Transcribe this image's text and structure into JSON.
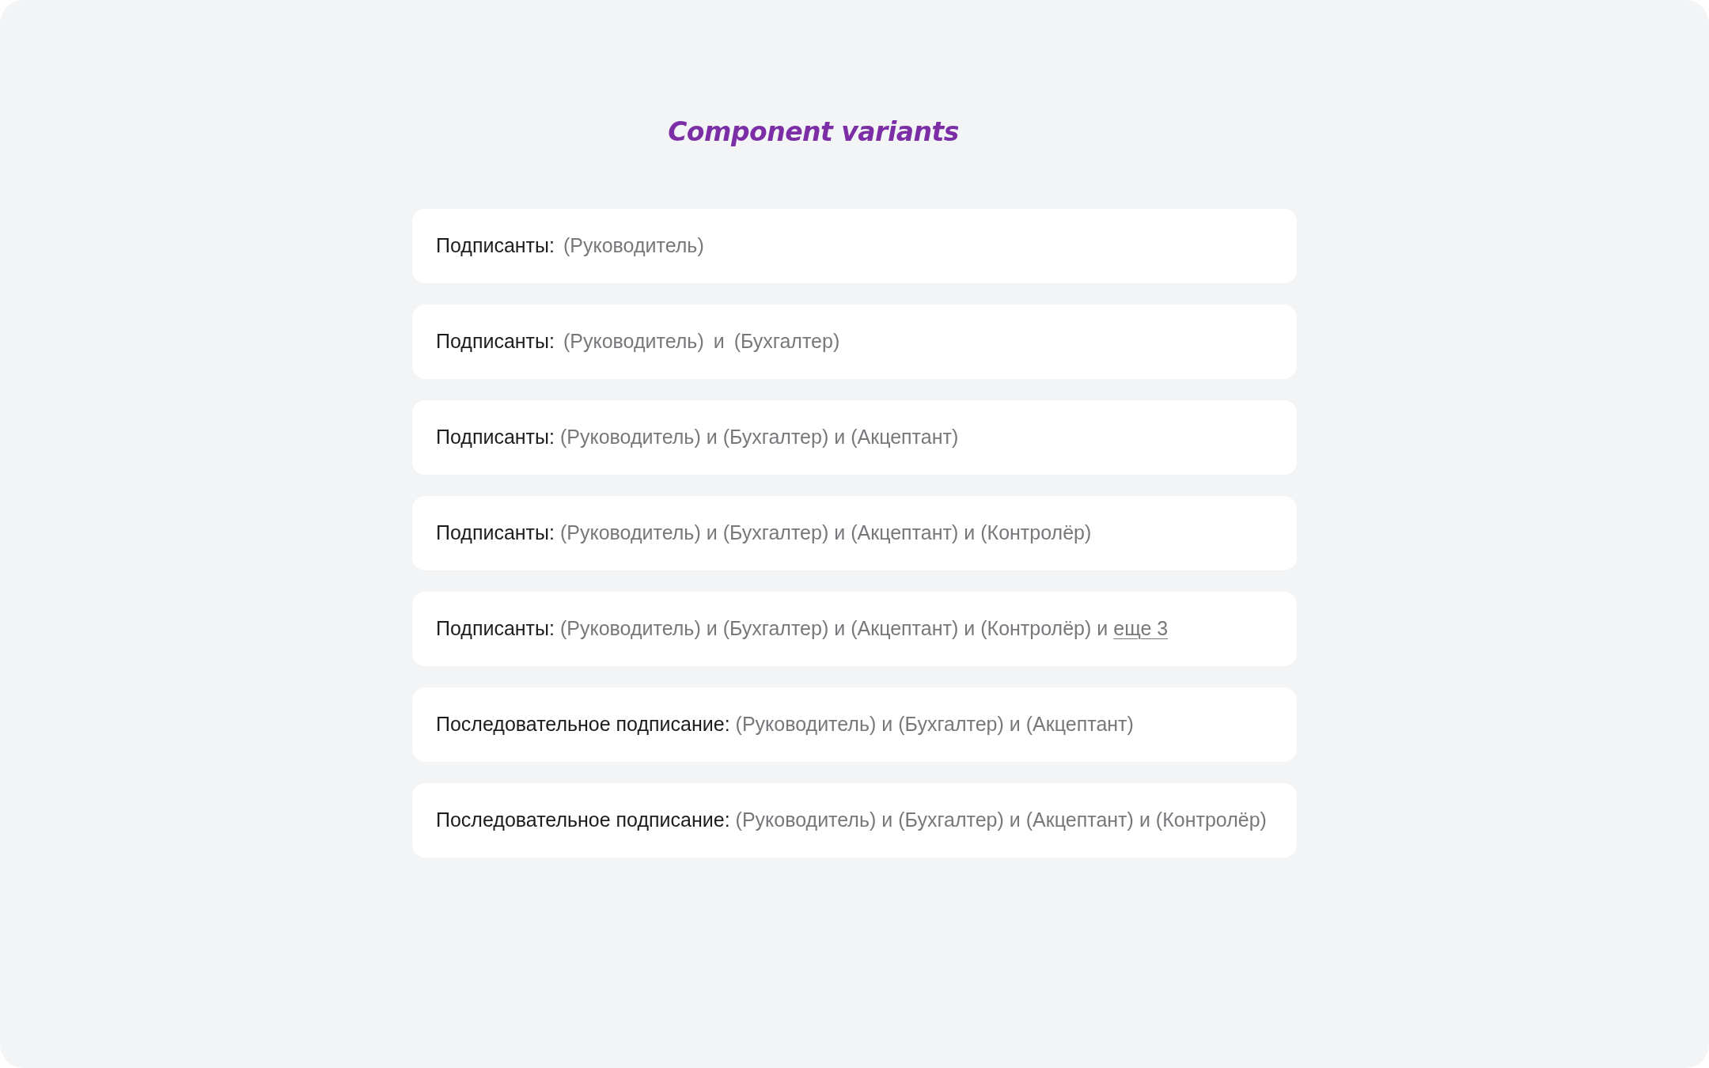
{
  "title": "Component variants",
  "rows": [
    {
      "kind": "spaced",
      "label": "Подписанты:",
      "parts": [
        {
          "kind": "role",
          "text": "(Руководитель)"
        }
      ]
    },
    {
      "kind": "spaced",
      "label": "Подписанты:",
      "parts": [
        {
          "kind": "role",
          "text": "(Руководитель)"
        },
        {
          "kind": "conjunction",
          "text": "и"
        },
        {
          "kind": "role",
          "text": "(Бухгалтер)"
        }
      ]
    },
    {
      "kind": "compact",
      "label": "Подписанты:",
      "parts": [
        {
          "kind": "role",
          "text": "(Руководитель)"
        },
        {
          "kind": "conjunction",
          "text": "и"
        },
        {
          "kind": "role",
          "text": "(Бухгалтер)"
        },
        {
          "kind": "conjunction",
          "text": "и"
        },
        {
          "kind": "role",
          "text": "(Акцептант)"
        }
      ]
    },
    {
      "kind": "compact",
      "label": "Подписанты:",
      "parts": [
        {
          "kind": "role",
          "text": "(Руководитель)"
        },
        {
          "kind": "conjunction",
          "text": "и"
        },
        {
          "kind": "role",
          "text": "(Бухгалтер)"
        },
        {
          "kind": "conjunction",
          "text": "и"
        },
        {
          "kind": "role",
          "text": "(Акцептант)"
        },
        {
          "kind": "conjunction",
          "text": "и"
        },
        {
          "kind": "role",
          "text": "(Контролёр)"
        }
      ]
    },
    {
      "kind": "compact",
      "label": "Подписанты:",
      "parts": [
        {
          "kind": "role",
          "text": "(Руководитель)"
        },
        {
          "kind": "conjunction",
          "text": "и"
        },
        {
          "kind": "role",
          "text": "(Бухгалтер)"
        },
        {
          "kind": "conjunction",
          "text": "и"
        },
        {
          "kind": "role",
          "text": "(Акцептант)"
        },
        {
          "kind": "conjunction",
          "text": "и"
        },
        {
          "kind": "role",
          "text": "(Контролёр)"
        },
        {
          "kind": "conjunction",
          "text": "и"
        },
        {
          "kind": "link",
          "text": "еще 3"
        }
      ]
    },
    {
      "kind": "compact",
      "label": "Последовательное подписание:",
      "parts": [
        {
          "kind": "role",
          "text": "(Руководитель)"
        },
        {
          "kind": "conjunction",
          "text": "и"
        },
        {
          "kind": "role",
          "text": "(Бухгалтер)"
        },
        {
          "kind": "conjunction",
          "text": "и"
        },
        {
          "kind": "role",
          "text": "(Акцептант)"
        }
      ]
    },
    {
      "kind": "compact",
      "label": "Последовательное подписание:",
      "parts": [
        {
          "kind": "role",
          "text": "(Руководитель)"
        },
        {
          "kind": "conjunction",
          "text": "и"
        },
        {
          "kind": "role",
          "text": "(Бухгалтер)"
        },
        {
          "kind": "conjunction",
          "text": "и"
        },
        {
          "kind": "role",
          "text": "(Акцептант)"
        },
        {
          "kind": "conjunction",
          "text": "и"
        },
        {
          "kind": "role",
          "text": "(Контролёр)"
        }
      ]
    }
  ]
}
